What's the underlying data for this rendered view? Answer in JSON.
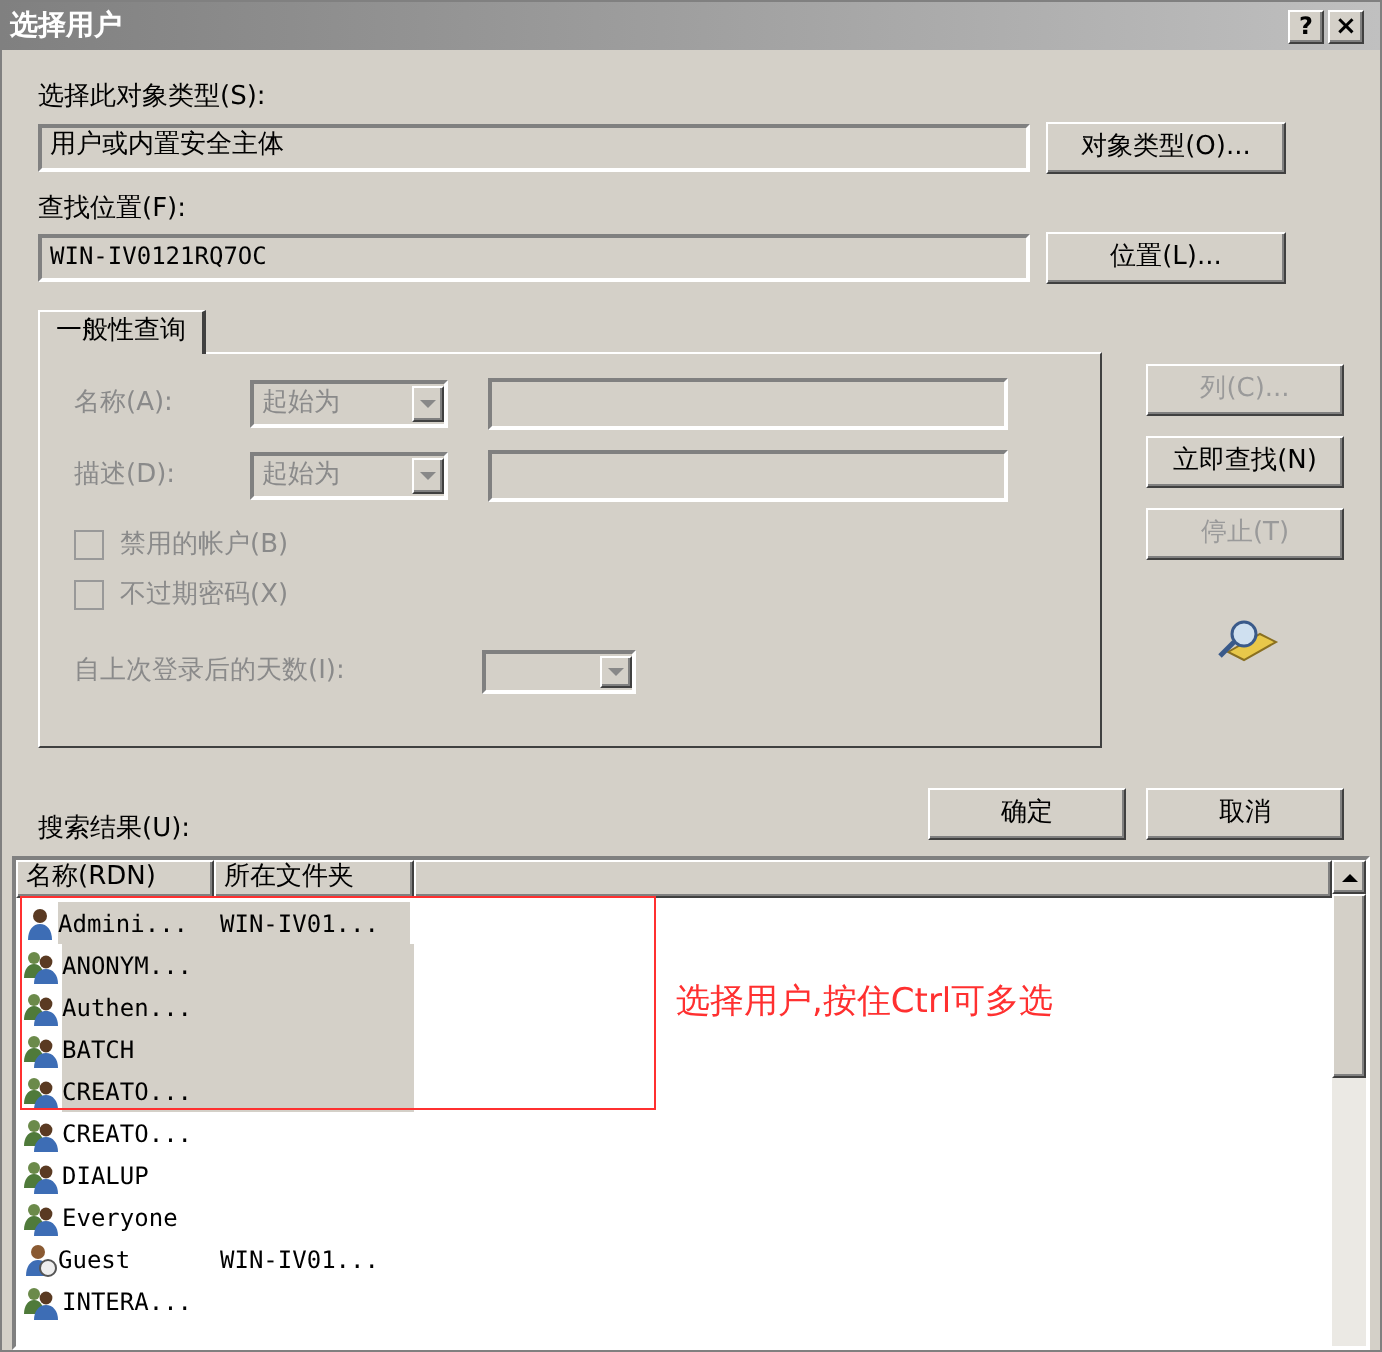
{
  "window": {
    "title": "选择用户",
    "help_button": "?",
    "close_button": "×"
  },
  "object_type": {
    "label": "选择此对象类型(S):",
    "value": "用户或内置安全主体",
    "button": "对象类型(O)..."
  },
  "location": {
    "label": "查找位置(F):",
    "value": "WIN-IV0121RQ7OC",
    "button": "位置(L)..."
  },
  "tabs": [
    {
      "label": "一般性查询",
      "selected": true
    }
  ],
  "query": {
    "name_label": "名称(A):",
    "name_mode": "起始为",
    "desc_label": "描述(D):",
    "desc_mode": "起始为",
    "checkboxes": [
      {
        "label": "禁用的帐户(B)",
        "checked": false,
        "disabled": true
      },
      {
        "label": "不过期密码(X)",
        "checked": false,
        "disabled": true
      }
    ],
    "days_label": "自上次登录后的天数(I):"
  },
  "side_buttons": [
    {
      "label": "列(C)...",
      "disabled": true
    },
    {
      "label": "立即查找(N)",
      "disabled": false
    },
    {
      "label": "停止(T)",
      "disabled": true
    }
  ],
  "ok_button": "确定",
  "cancel_button": "取消",
  "results_label": "搜索结果(U):",
  "results": {
    "columns": [
      "名称(RDN)",
      "所在文件夹"
    ],
    "rows": [
      {
        "kind": "user",
        "name": "Admini...",
        "folder": "WIN-IV01...",
        "selected": true
      },
      {
        "kind": "group",
        "name": "ANONYM...",
        "selected": true
      },
      {
        "kind": "group",
        "name": "Authen...",
        "selected": true
      },
      {
        "kind": "group",
        "name": "BATCH",
        "selected": true
      },
      {
        "kind": "group",
        "name": "CREATO...",
        "selected": true
      },
      {
        "kind": "group",
        "name": "CREATO...",
        "selected": false
      },
      {
        "kind": "group",
        "name": "DIALUP",
        "selected": false
      },
      {
        "kind": "group",
        "name": "Everyone",
        "selected": false
      },
      {
        "kind": "guest",
        "name": "Guest",
        "folder": "WIN-IV01...",
        "selected": false
      },
      {
        "kind": "group",
        "name": "INTERA...",
        "selected": false
      }
    ]
  },
  "annotation": {
    "text": "选择用户,按住Ctrl可多选"
  }
}
